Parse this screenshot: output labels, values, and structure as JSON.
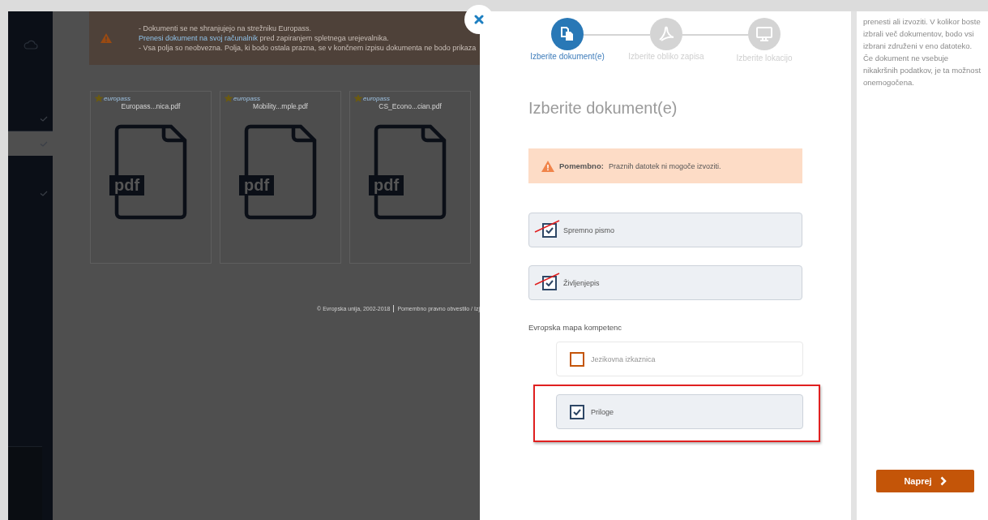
{
  "sidebar": {
    "items": [
      {
        "selected": false
      },
      {
        "selected": true
      },
      {
        "selected": false
      }
    ]
  },
  "background_page": {
    "notice": {
      "lines": [
        {
          "kind": "text",
          "text": "- Dokumenti se ne shranjujejo na strežniku Europass."
        },
        {
          "kind": "link",
          "link": "Prenesi dokument na svoj računalnik",
          "text": " pred zapiranjem spletnega urejevalnika."
        },
        {
          "kind": "text",
          "text": "- Vsa polja so neobvezna. Polja, ki bodo ostala prazna, se v končnem izpisu dokumenta ne bodo prikaza"
        }
      ]
    },
    "files": [
      {
        "logo": "europass",
        "name": "Europass...nica.pdf",
        "icon_label": "pdf"
      },
      {
        "logo": "europass",
        "name": "Mobility...mple.pdf",
        "icon_label": "pdf"
      },
      {
        "logo": "europass",
        "name": "CS_Econo...cian.pdf",
        "icon_label": "pdf"
      }
    ],
    "footer": [
      "© Evropska unija, 2002-2018",
      "Pomembno pravno obvestilo / Izj"
    ]
  },
  "dialog": {
    "steps": [
      {
        "label": "Izberite dokument(e)",
        "selected": true
      },
      {
        "label": "Izberite obliko zapisa",
        "selected": false
      },
      {
        "label": "Izberite lokacijo",
        "selected": false
      }
    ],
    "title": "Izberite dokument(e)",
    "alert": {
      "label": "Pomembno:",
      "text": "Praznih datotek ni mogoče izvoziti."
    },
    "documents": [
      {
        "label": "Spremno pismo",
        "checked": true,
        "struck": true
      },
      {
        "label": "Življenjepis",
        "checked": true,
        "struck": true
      }
    ],
    "section_label": "Evropska mapa kompetenc",
    "section_documents": [
      {
        "label": "Jezikovna izkaznica",
        "checked": false,
        "disabled": true,
        "highlighted": false
      },
      {
        "label": "Priloge",
        "checked": true,
        "disabled": false,
        "highlighted": true
      }
    ]
  },
  "help": {
    "text": "prenesti ali izvoziti. V kolikor boste izbrali več dokumentov, bodo vsi izbrani združeni v eno datoteko. Če dokument ne vsebuje nikakršnih podatkov, je ta možnost onemogočena.",
    "next_button": "Naprej"
  }
}
